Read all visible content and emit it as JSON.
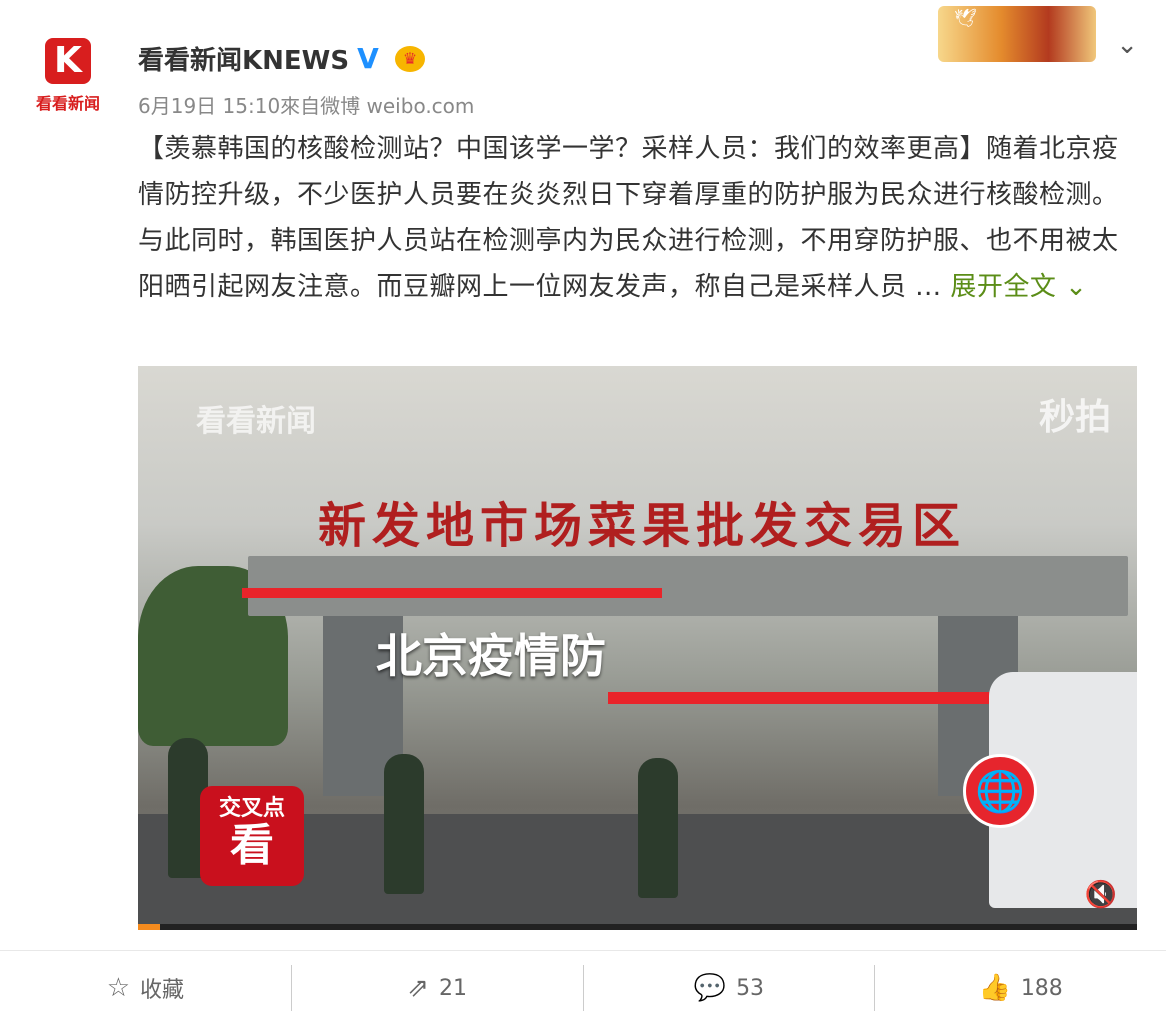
{
  "account": {
    "avatar_letter": "K",
    "avatar_text": "看看新闻",
    "name": "看看新闻KNEWS",
    "verified_icon": "verified-v-icon",
    "member_icon": "crown-icon"
  },
  "post": {
    "meta": "6月19日 15:10來自微博 weibo.com",
    "text": "【羡慕韩国的核酸检测站？中国该学一学？采样人员：我们的效率更高】随着北京疫情防控升级，不少医护人员要在炎炎烈日下穿着厚重的防护服为民众进行核酸检测。与此同时，韩国医护人员站在检测亭内为民众进行检测，不用穿防护服、也不用被太阳晒引起网友注意。而豆瓣网上一位网友发声，称自己是采样人员 ...",
    "expand_label": "展开全文"
  },
  "video": {
    "watermark": "看看新闻",
    "watermark_right": "秒拍",
    "sign_text": "新发地市场菜果批发交易区",
    "overlay_text": "北京疫情防",
    "logo_top": "交叉点",
    "logo_big": "看",
    "progress_fraction": 0.022
  },
  "actions": {
    "favorite_label": "收藏",
    "repost_count": "21",
    "comment_count": "53",
    "like_count": "188"
  }
}
